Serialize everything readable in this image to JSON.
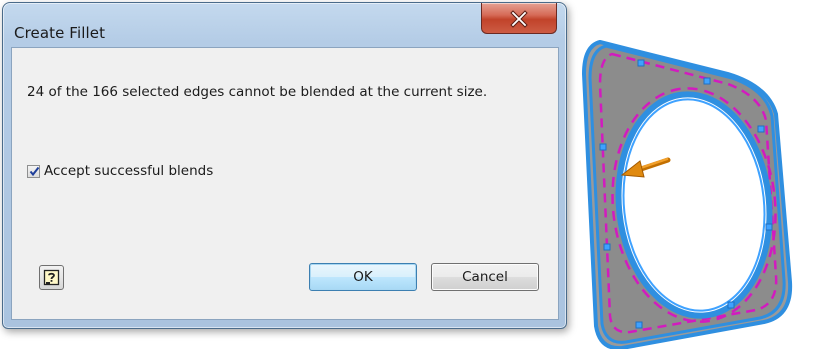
{
  "dialog": {
    "title": "Create Fillet",
    "message": "24 of the 166 selected edges cannot be blended at the current size.",
    "checkbox": {
      "label": "Accept successful blends",
      "checked": true
    },
    "buttons": {
      "ok_label": "OK",
      "cancel_label": "Cancel"
    },
    "icons": {
      "close": "close-icon",
      "help": "help-icon"
    }
  },
  "viewport": {
    "model": "rounded-square-ring-part",
    "arrow_icon": "arrow-left-icon"
  },
  "colors": {
    "titlebar": "#b4cce6",
    "close_button": "#c9483a",
    "ok_border": "#3c7fb1",
    "edge_highlight": "#2f8fe0",
    "failed_edge": "#d21bbf",
    "arrow": "#e08a10",
    "part_face": "#8c8c8c"
  }
}
